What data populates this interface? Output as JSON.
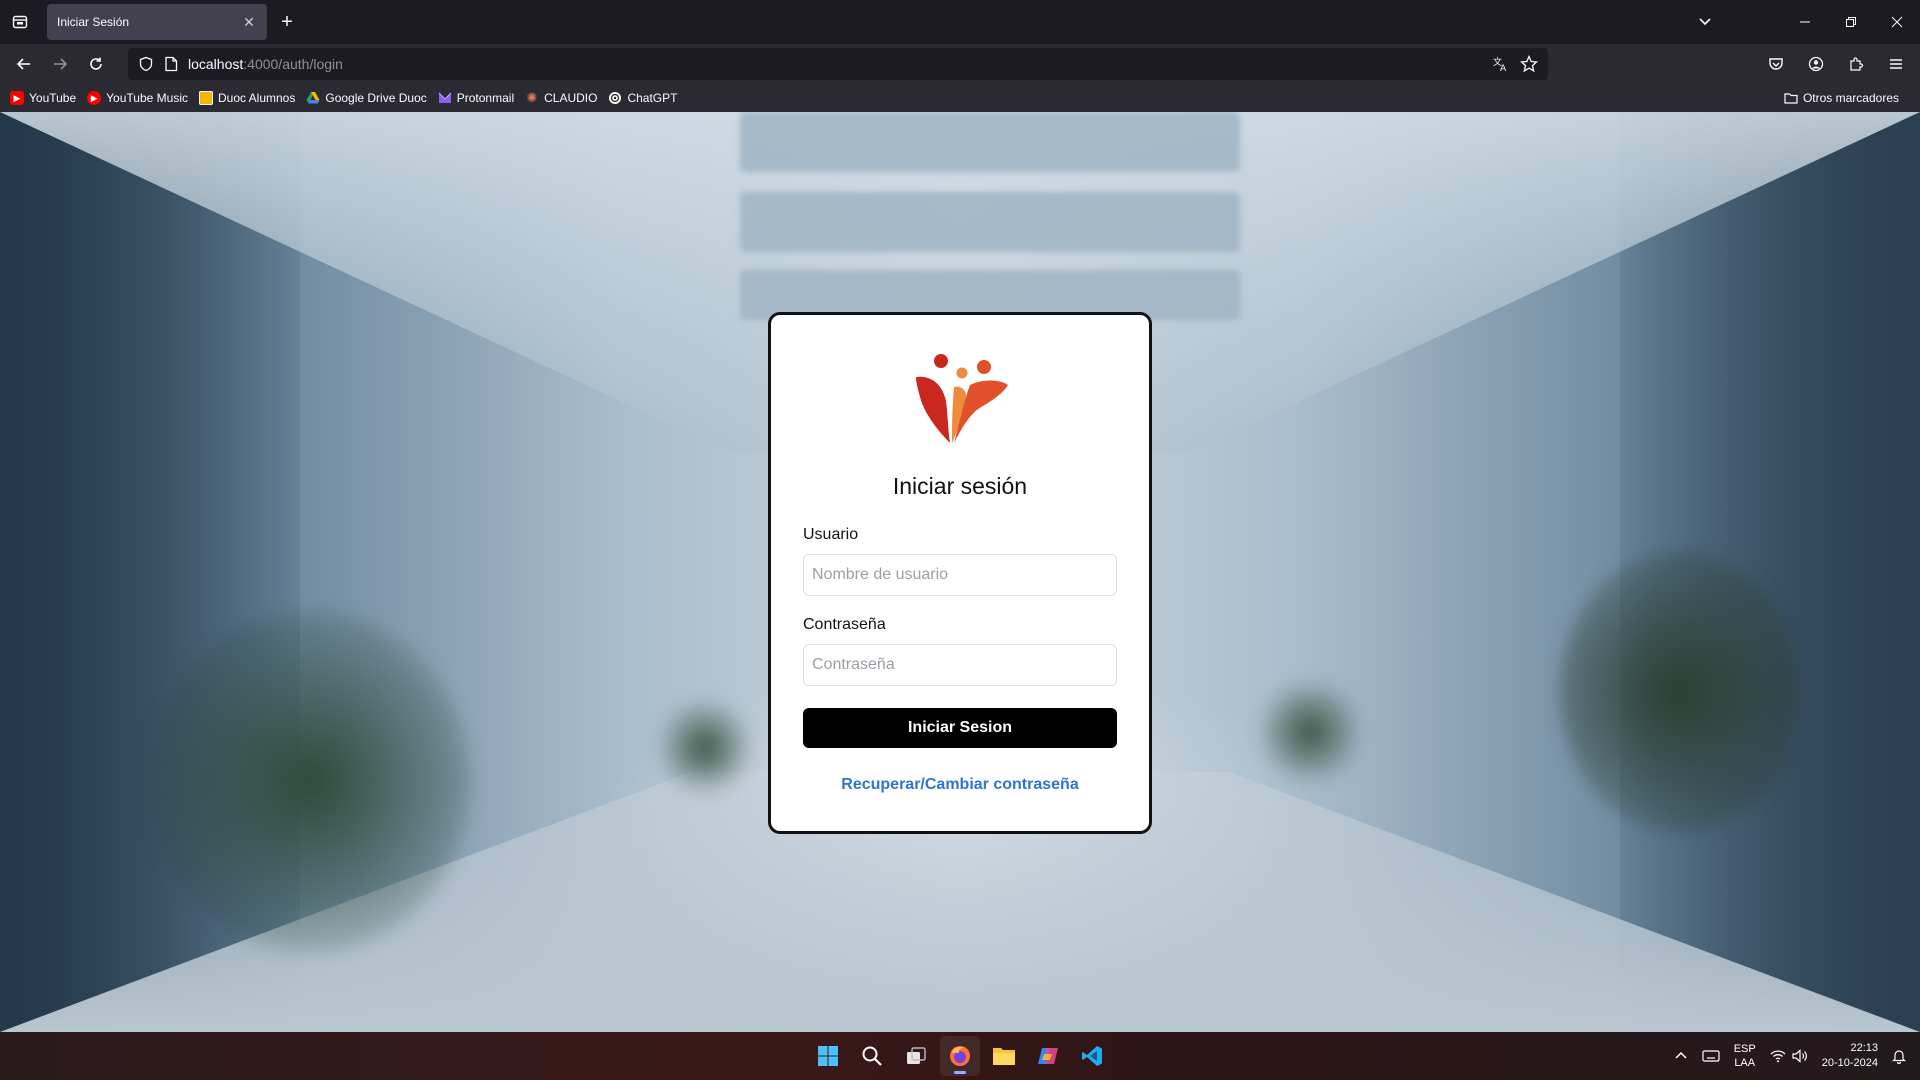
{
  "browser": {
    "tab_title": "Iniciar Sesión",
    "url_host": "localhost",
    "url_path": ":4000/auth/login",
    "bookmarks": [
      {
        "label": "YouTube",
        "icon": "youtube-icon",
        "color": "#ff0000"
      },
      {
        "label": "YouTube Music",
        "icon": "youtube-music-icon",
        "color": "#ff0000"
      },
      {
        "label": "Duoc Alumnos",
        "icon": "duoc-icon",
        "color": "#f5b400"
      },
      {
        "label": "Google Drive Duoc",
        "icon": "google-drive-icon",
        "color": "#1fa463"
      },
      {
        "label": "Protonmail",
        "icon": "protonmail-icon",
        "color": "#8b5cf6"
      },
      {
        "label": "CLAUDIO",
        "icon": "claude-icon",
        "color": "#d97757"
      },
      {
        "label": "ChatGPT",
        "icon": "chatgpt-icon",
        "color": "#ffffff"
      }
    ],
    "other_bookmarks": "Otros marcadores"
  },
  "login": {
    "title": "Iniciar sesión",
    "username_label": "Usuario",
    "username_placeholder": "Nombre de usuario",
    "password_label": "Contraseña",
    "password_placeholder": "Contraseña",
    "submit_label": "Iniciar Sesion",
    "recover_link": "Recuperar/Cambiar contraseña",
    "accent_color": "#2f74d0"
  },
  "taskbar": {
    "lang_top": "ESP",
    "lang_bottom": "LAA",
    "time": "22:13",
    "date": "20-10-2024"
  }
}
